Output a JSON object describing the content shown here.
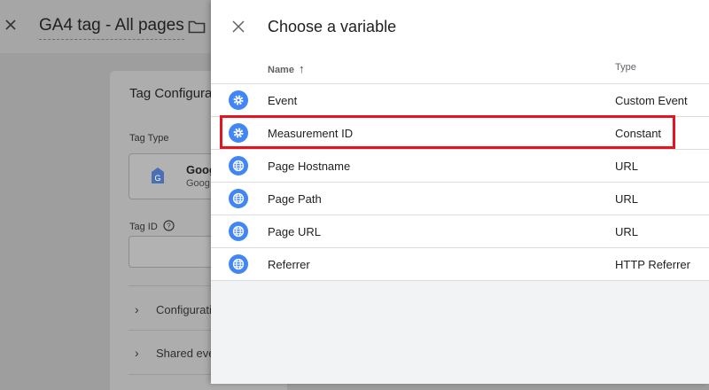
{
  "background": {
    "tag_title": "GA4 tag - All pages",
    "card_title": "Tag Configura",
    "tag_type_label": "Tag Type",
    "tag_name_partial": "Goog",
    "tag_sub_partial": "Goog",
    "tag_id_label": "Tag ID",
    "rows": [
      {
        "label": "Configurati"
      },
      {
        "label": "Shared eve"
      }
    ]
  },
  "drawer": {
    "title": "Choose a variable",
    "columns": {
      "name": "Name",
      "type": "Type",
      "sort": "ascending"
    },
    "variables": [
      {
        "name": "Event",
        "type": "Custom Event",
        "icon": "gear-icon"
      },
      {
        "name": "Measurement ID",
        "type": "Constant",
        "icon": "gear-icon"
      },
      {
        "name": "Page Hostname",
        "type": "URL",
        "icon": "globe-icon"
      },
      {
        "name": "Page Path",
        "type": "URL",
        "icon": "globe-icon"
      },
      {
        "name": "Page URL",
        "type": "URL",
        "icon": "globe-icon"
      },
      {
        "name": "Referrer",
        "type": "HTTP Referrer",
        "icon": "globe-icon"
      }
    ]
  },
  "colors": {
    "icon_blue": "#4285f4",
    "highlight_red": "#e4151f"
  }
}
